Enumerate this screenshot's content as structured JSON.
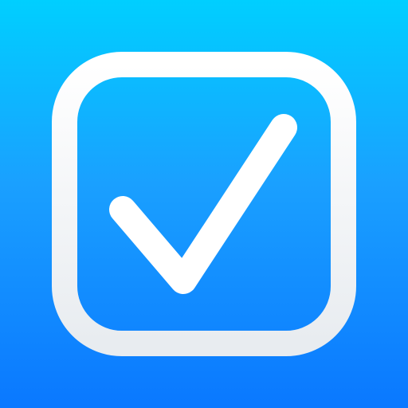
{
  "icon": {
    "name": "checkbox-checked-icon",
    "colors": {
      "gradient_top": "#00CFFF",
      "gradient_mid": "#1AA0FF",
      "gradient_bottom": "#0A78FF",
      "glyph": "#FFFFFF",
      "frame_shadow": "#E8ECF0"
    }
  }
}
